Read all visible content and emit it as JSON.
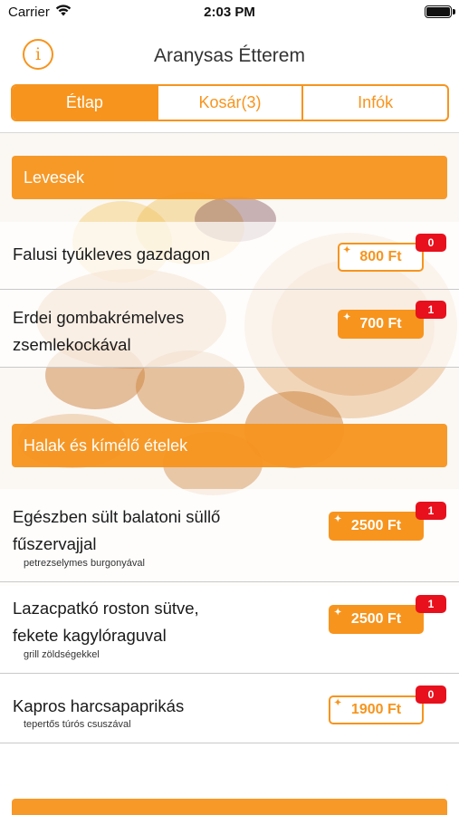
{
  "status_bar": {
    "carrier": "Carrier",
    "time": "2:03 PM"
  },
  "header": {
    "title": "Aranysas Étterem",
    "info_icon": "i"
  },
  "tabs": [
    {
      "label": "Étlap",
      "active": true
    },
    {
      "label": "Kosár(3)",
      "active": false
    },
    {
      "label": "Infók",
      "active": false
    }
  ],
  "sections": [
    {
      "title": "Levesek",
      "items": [
        {
          "name_line1": "Falusi tyúkleves gazdagon",
          "name_line2": "",
          "subtitle": "",
          "price": "800 Ft",
          "badge": "0"
        },
        {
          "name_line1": "Erdei gombakrémelves",
          "name_line2": "zsemlekockával",
          "subtitle": "",
          "price": "700 Ft",
          "badge": "1"
        }
      ]
    },
    {
      "title": "Halak és kímélő ételek",
      "items": [
        {
          "name_line1": "Egészben sült balatoni süllő",
          "name_line2": "fűszervajjal",
          "subtitle": "petrezselymes burgonyával",
          "price": "2500 Ft",
          "badge": "1"
        },
        {
          "name_line1": "Lazacpatkó roston sütve,",
          "name_line2": "fekete kagylóraguval",
          "subtitle": "grill zöldségekkel",
          "price": "2500 Ft",
          "badge": "1"
        },
        {
          "name_line1": "Kapros harcsapaprikás",
          "name_line2": "",
          "subtitle": "tepertős túrós csuszával",
          "price": "1900 Ft",
          "badge": "0"
        }
      ]
    }
  ],
  "colors": {
    "accent": "#f7941d",
    "badge": "#e8101c"
  },
  "icons": {
    "wifi": "wifi-icon",
    "battery": "battery-icon",
    "info": "info-icon",
    "price_spark": "sparkle-icon"
  }
}
